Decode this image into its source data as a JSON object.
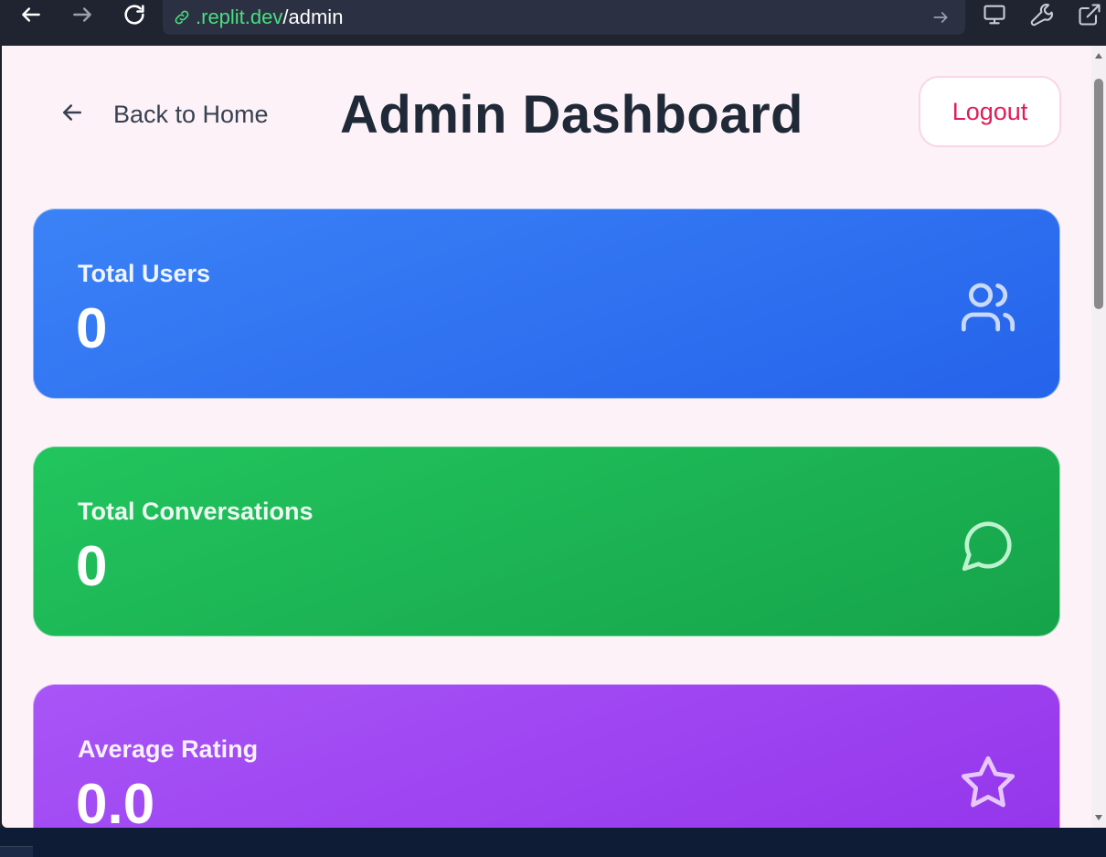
{
  "browser": {
    "url_host": ".replit.dev",
    "url_path": "/admin",
    "icons": [
      "back-arrow-icon",
      "forward-arrow-icon",
      "reload-icon",
      "link-icon",
      "go-icon",
      "monitor-icon",
      "wrench-icon",
      "external-link-icon"
    ]
  },
  "header": {
    "back_label": "Back to Home",
    "title": "Admin Dashboard",
    "logout_label": "Logout"
  },
  "stats": [
    {
      "label": "Total Users",
      "value": "0",
      "color": "#2563eb",
      "icon": "users-icon"
    },
    {
      "label": "Total Conversations",
      "value": "0",
      "color": "#16a34a",
      "icon": "message-circle-icon"
    },
    {
      "label": "Average Rating",
      "value": "0.0",
      "color": "#9333ea",
      "icon": "star-icon"
    }
  ],
  "colors": {
    "page_background": "#fdf2f8",
    "title": "#1f2937",
    "logout_text": "#e11d58",
    "url_host": "#4ade80"
  }
}
